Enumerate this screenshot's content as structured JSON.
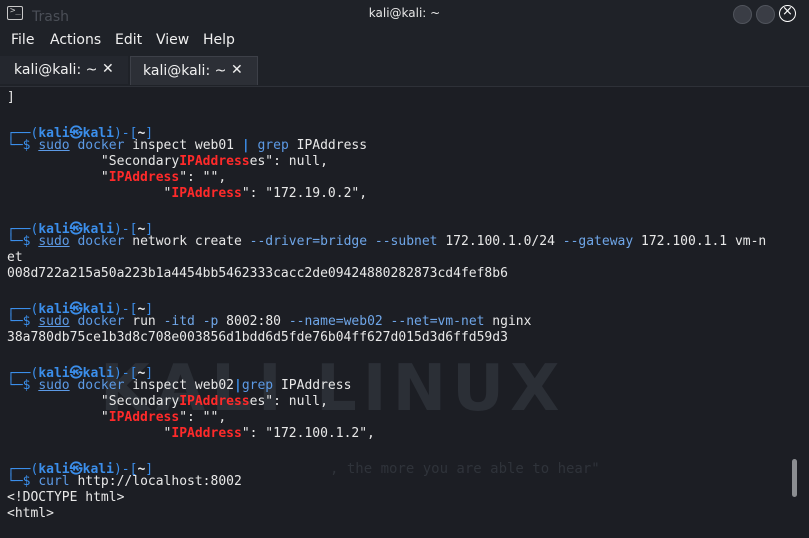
{
  "window": {
    "title": "kali@kali: ~",
    "desktop_ghost": "Trash",
    "close_glyph": "×"
  },
  "menu": [
    "File",
    "Actions",
    "Edit",
    "View",
    "Help"
  ],
  "tabs": [
    {
      "label": "kali@kali: ~",
      "close": "✕",
      "active": false
    },
    {
      "label": "kali@kali: ~",
      "close": "✕",
      "active": true
    }
  ],
  "background": {
    "watermark": "KALI LINUX",
    "tagline": ", the more you are able to hear\""
  },
  "terminal": {
    "prompt_user": "kali",
    "prompt_host": "kali",
    "prompt_dir": "~",
    "prompt_at": "㉿",
    "line_bracket": "]",
    "cmd1": {
      "sudo": "sudo",
      "docker": "docker",
      "args": " inspect web01 ",
      "pipe": "|",
      "grep": "grep",
      "grep_arg": " IPAddress"
    },
    "out1": [
      {
        "pre": "            \"Secondary",
        "hl": "IPAddress",
        "post": "es\": null,"
      },
      {
        "pre": "            \"",
        "hl": "IPAddress",
        "post": "\": \"\","
      },
      {
        "pre": "                    \"",
        "hl": "IPAddress",
        "post": "\": \"172.19.0.2\","
      }
    ],
    "cmd2": {
      "sudo": "sudo",
      "docker": "docker",
      "args": " network create ",
      "o1": "--driver=bridge",
      "o2": " --subnet",
      "v2": " 172.100.1.0/24 ",
      "o3": "--gateway",
      "v3": " 172.100.1.1 vm-n"
    },
    "cmd2_wrap": "et",
    "out2": "008d722a215a50a223b1a4454bb5462333cacc2de09424880282873cd4fef8b6",
    "cmd3": {
      "sudo": "sudo",
      "docker": "docker",
      "args": " run ",
      "o1": "-itd",
      "o2": " -p",
      "v2": " 8002:80 ",
      "o3": "--name=web02",
      "o4": " --net=vm-net",
      "v4": " nginx"
    },
    "out3": "38a780db75ce1b3d8c708e003856d1bdd6d5fde76b04ff627d015d3d6ffd59d3",
    "cmd4": {
      "sudo": "sudo",
      "docker": "docker",
      "args": " inspect web02",
      "pipe": "|",
      "grep": "grep",
      "grep_arg": " IPAddress"
    },
    "out4": [
      {
        "pre": "            \"Secondary",
        "hl": "IPAddress",
        "post": "es\": null,"
      },
      {
        "pre": "            \"",
        "hl": "IPAddress",
        "post": "\": \"\","
      },
      {
        "pre": "                    \"",
        "hl": "IPAddress",
        "post": "\": \"172.100.1.2\","
      }
    ],
    "cmd5": {
      "curl": "curl",
      "args": " http://localhost:8002"
    },
    "out5": [
      "<!DOCTYPE html>",
      "<html>"
    ]
  },
  "colors": {
    "prompt": "#3b8eea",
    "highlight": "#ff2a2a",
    "background": "#1c1e24"
  }
}
